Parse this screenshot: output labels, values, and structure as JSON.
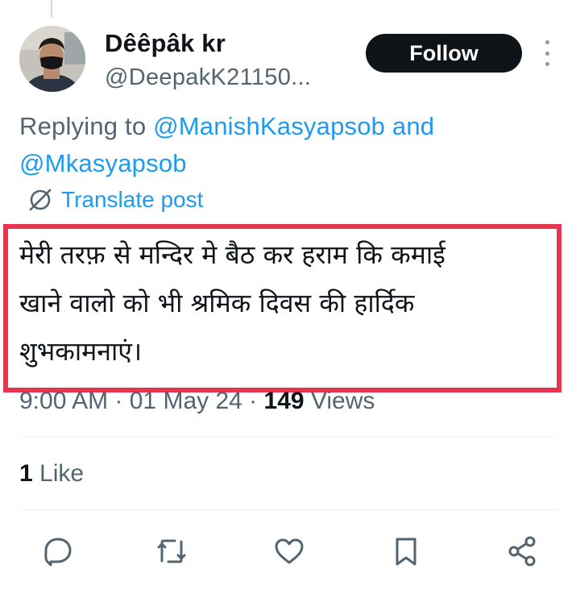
{
  "author": {
    "display_name": "Dêêpâk kr",
    "handle": "@DeepakK21150..."
  },
  "follow_label": "Follow",
  "reply": {
    "prefix": "Replying to ",
    "mention_1": "@ManishKasyapsob",
    "conjunction": " and ",
    "mention_2": "@Mkasyapsob"
  },
  "translate_label": "Translate post",
  "tweet": {
    "lines": [
      "मेरी तरफ़ से मन्दिर मे बैठ कर हराम कि कमाई",
      "खाने वालो को भी श्रमिक दिवस की हार्दिक",
      "शुभकामनाएं।"
    ]
  },
  "meta": {
    "time": "9:00 AM",
    "separator": " · ",
    "date": "01 May 24",
    "views_count": "149",
    "views_label": " Views"
  },
  "likes": {
    "count": "1",
    "label": " Like"
  },
  "actions": {
    "reply_icon": "reply-icon",
    "retweet_icon": "retweet-icon",
    "like_icon": "heart-icon",
    "bookmark_icon": "bookmark-icon",
    "share_icon": "share-icon"
  },
  "colors": {
    "link": "#1d9bf0",
    "secondary_text": "#536471",
    "primary_text": "#0f1419",
    "highlight_border": "#e8354f",
    "button_bg": "#0f1419"
  }
}
